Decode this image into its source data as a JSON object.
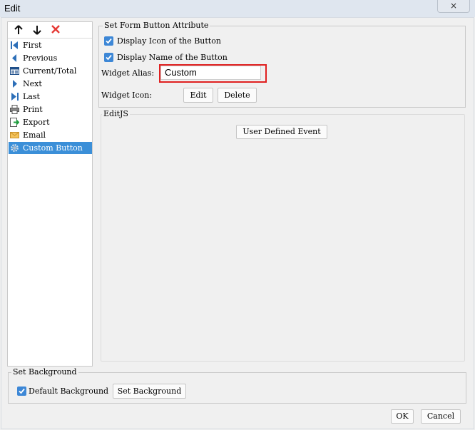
{
  "window": {
    "title": "Edit",
    "close_glyph": "×"
  },
  "toolbar": {
    "up_glyph": "🡑",
    "down_glyph": "🡓",
    "delete_glyph": "✕"
  },
  "widgets": [
    {
      "label": "First",
      "icon": "first-icon"
    },
    {
      "label": "Previous",
      "icon": "previous-icon"
    },
    {
      "label": "Current/Total",
      "icon": "current-total-icon"
    },
    {
      "label": "Next",
      "icon": "next-icon"
    },
    {
      "label": "Last",
      "icon": "last-icon"
    },
    {
      "label": "Print",
      "icon": "print-icon"
    },
    {
      "label": "Export",
      "icon": "export-icon"
    },
    {
      "label": "Email",
      "icon": "email-icon"
    },
    {
      "label": "Custom Button",
      "icon": "gear-icon",
      "selected": true
    }
  ],
  "attr": {
    "group_title": "Set Form Button Attribute",
    "display_icon_label": "Display Icon of the Button",
    "display_icon_checked": true,
    "display_name_label": "Display Name of the Button",
    "display_name_checked": true,
    "alias_label": "Widget Alias:",
    "alias_value": "Custom",
    "icon_label": "Widget Icon:",
    "edit_button": "Edit",
    "delete_button": "Delete"
  },
  "editjs": {
    "title": "EditJS",
    "user_defined_event_button": "User Defined Event"
  },
  "background": {
    "group_title": "Set Background",
    "default_label": "Default Background",
    "default_checked": true,
    "set_button": "Set Background"
  },
  "footer": {
    "ok_button": "OK",
    "cancel_button": "Cancel"
  },
  "colors": {
    "accent": "#3b8fd8",
    "highlight": "#e02020",
    "delete_red": "#e53935"
  }
}
